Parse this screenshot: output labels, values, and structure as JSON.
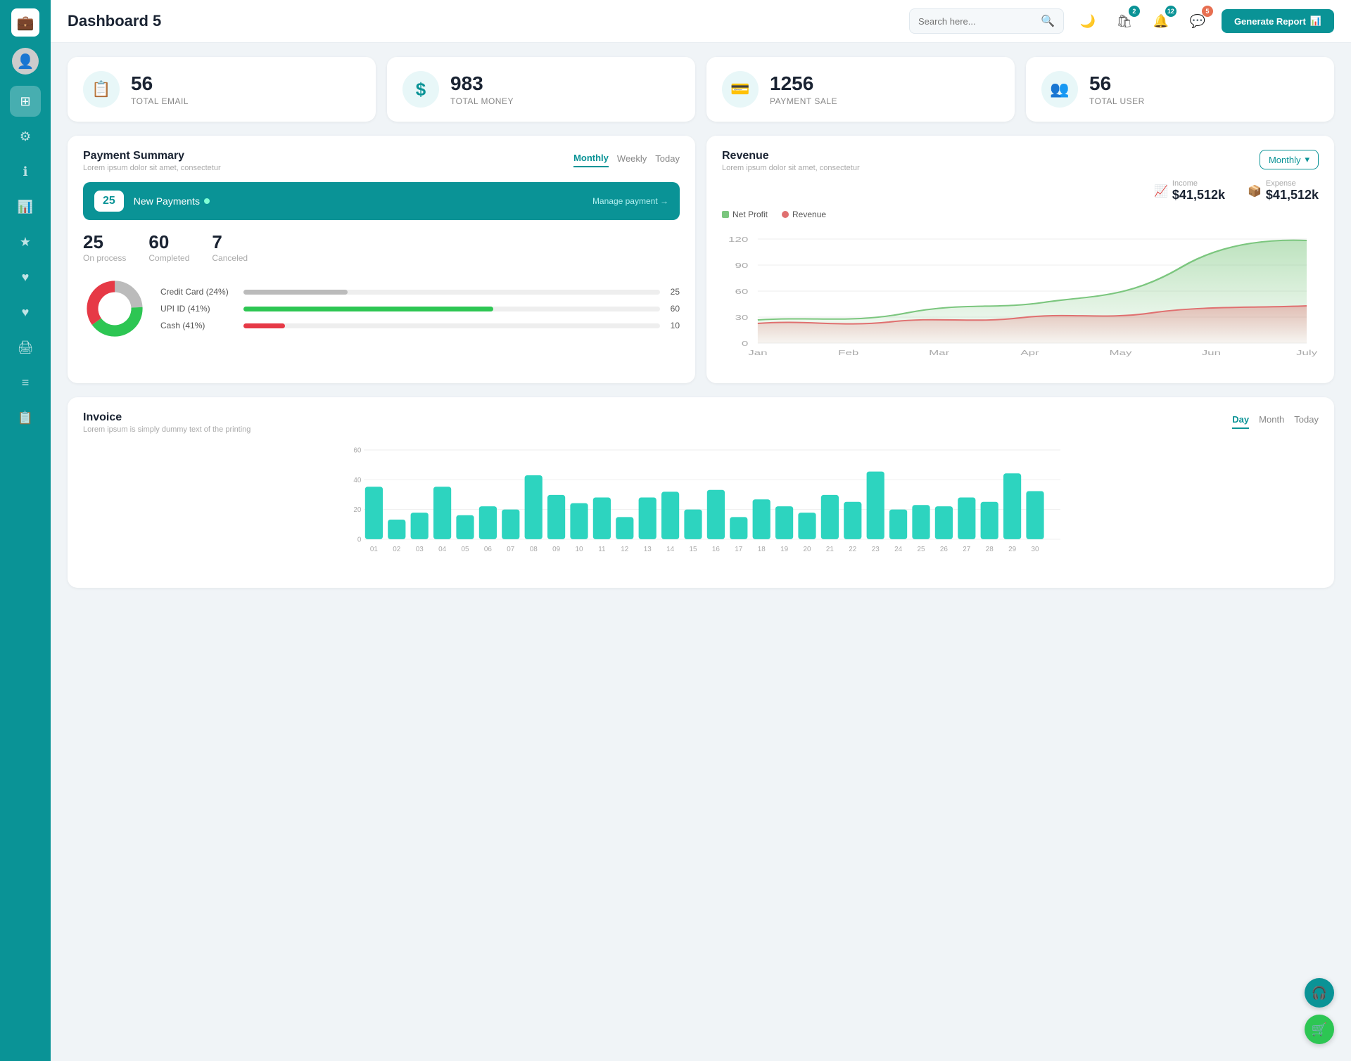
{
  "sidebar": {
    "logo_icon": "💼",
    "items": [
      {
        "name": "dashboard",
        "icon": "⊞",
        "active": true
      },
      {
        "name": "settings",
        "icon": "⚙"
      },
      {
        "name": "info",
        "icon": "ℹ"
      },
      {
        "name": "analytics",
        "icon": "📊"
      },
      {
        "name": "favorites",
        "icon": "★"
      },
      {
        "name": "favorites2",
        "icon": "♥"
      },
      {
        "name": "favorites3",
        "icon": "♥"
      },
      {
        "name": "print",
        "icon": "🖨"
      },
      {
        "name": "list",
        "icon": "≡"
      },
      {
        "name": "clipboard",
        "icon": "📋"
      }
    ]
  },
  "header": {
    "title": "Dashboard 5",
    "search_placeholder": "Search here...",
    "icons": [
      {
        "name": "moon",
        "icon": "🌙",
        "badge": null
      },
      {
        "name": "cart",
        "icon": "🛍",
        "badge": "2",
        "badge_color": "teal"
      },
      {
        "name": "bell",
        "icon": "🔔",
        "badge": "12",
        "badge_color": "teal"
      },
      {
        "name": "chat",
        "icon": "💬",
        "badge": "5",
        "badge_color": "orange"
      }
    ],
    "generate_btn": "Generate Report"
  },
  "stats": [
    {
      "id": "email",
      "icon": "📋",
      "number": "56",
      "label": "TOTAL EMAIL"
    },
    {
      "id": "money",
      "icon": "$",
      "number": "983",
      "label": "TOTAL MONEY"
    },
    {
      "id": "payment",
      "icon": "💳",
      "number": "1256",
      "label": "PAYMENT SALE"
    },
    {
      "id": "user",
      "icon": "👥",
      "number": "56",
      "label": "TOTAL USER"
    }
  ],
  "payment_summary": {
    "title": "Payment Summary",
    "subtitle": "Lorem ipsum dolor sit amet, consectetur",
    "tabs": [
      "Monthly",
      "Weekly",
      "Today"
    ],
    "active_tab": "Monthly",
    "new_payments_count": "25",
    "new_payments_label": "New Payments",
    "manage_link": "Manage payment →",
    "stats": [
      {
        "number": "25",
        "label": "On process"
      },
      {
        "number": "60",
        "label": "Completed"
      },
      {
        "number": "7",
        "label": "Canceled"
      }
    ],
    "methods": [
      {
        "label": "Credit Card (24%)",
        "value": 25,
        "max": 100,
        "color": "#bbb",
        "display": "25"
      },
      {
        "label": "UPI ID (41%)",
        "value": 60,
        "max": 100,
        "color": "#2dc653",
        "display": "60"
      },
      {
        "label": "Cash (41%)",
        "value": 10,
        "max": 100,
        "color": "#e63946",
        "display": "10"
      }
    ],
    "donut": {
      "segments": [
        {
          "pct": 24,
          "color": "#bbb"
        },
        {
          "pct": 41,
          "color": "#2dc653"
        },
        {
          "pct": 35,
          "color": "#e63946"
        }
      ]
    }
  },
  "revenue": {
    "title": "Revenue",
    "subtitle": "Lorem ipsum dolor sit amet, consectetur",
    "dropdown": "Monthly",
    "income": {
      "label": "Income",
      "value": "$41,512k",
      "icon": "📈"
    },
    "expense": {
      "label": "Expense",
      "value": "$41,512k",
      "icon": "📦"
    },
    "legend": [
      {
        "label": "Net Profit",
        "color": "#7bc67e"
      },
      {
        "label": "Revenue",
        "color": "#e07070"
      }
    ],
    "x_labels": [
      "Jan",
      "Feb",
      "Mar",
      "Apr",
      "May",
      "Jun",
      "July"
    ],
    "y_labels": [
      "0",
      "30",
      "60",
      "90",
      "120"
    ]
  },
  "invoice": {
    "title": "Invoice",
    "subtitle": "Lorem ipsum is simply dummy text of the printing",
    "tabs": [
      "Day",
      "Month",
      "Today"
    ],
    "active_tab": "Day",
    "y_labels": [
      "0",
      "20",
      "40",
      "60"
    ],
    "x_labels": [
      "01",
      "02",
      "03",
      "04",
      "05",
      "06",
      "07",
      "08",
      "09",
      "10",
      "11",
      "12",
      "13",
      "14",
      "15",
      "16",
      "17",
      "18",
      "19",
      "20",
      "21",
      "22",
      "23",
      "24",
      "25",
      "26",
      "27",
      "28",
      "29",
      "30"
    ],
    "bars": [
      35,
      12,
      18,
      35,
      16,
      22,
      20,
      43,
      30,
      24,
      28,
      15,
      28,
      32,
      20,
      33,
      15,
      27,
      22,
      18,
      30,
      25,
      45,
      20,
      23,
      22,
      28,
      25,
      44,
      32
    ]
  },
  "floating": {
    "support_icon": "🎧",
    "cart_icon": "🛒"
  },
  "colors": {
    "teal": "#0a9396",
    "light_teal": "#e8f7f8",
    "green": "#2dc653",
    "red": "#e63946",
    "gray": "#bbb"
  }
}
